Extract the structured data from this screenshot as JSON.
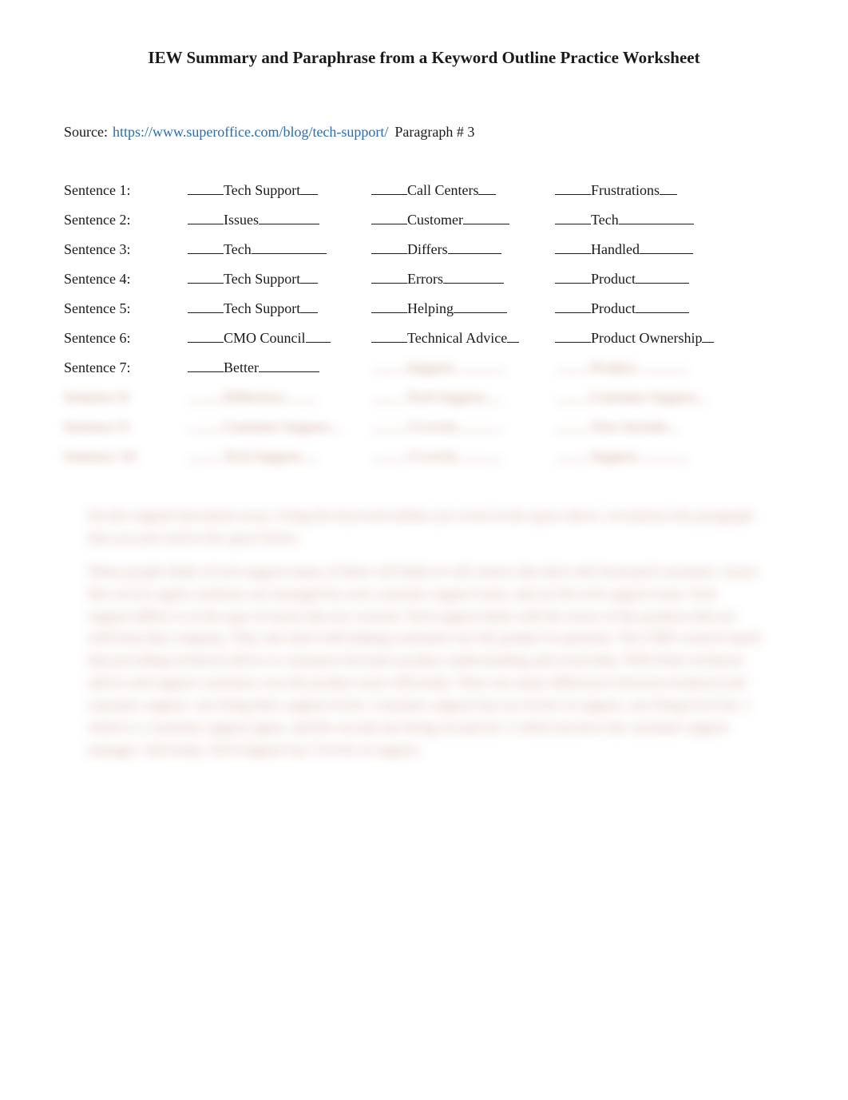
{
  "title": "IEW Summary and Paraphrase from a Keyword Outline Practice Worksheet",
  "source": {
    "label": "Source:",
    "url": "https://www.superoffice.com/blog/tech-support/",
    "paragraph_label": "Paragraph # 3"
  },
  "sentences": [
    {
      "label": "Sentence 1:",
      "keywords": [
        "Tech Support",
        "Call Centers",
        "Frustrations"
      ],
      "blurred": false
    },
    {
      "label": "Sentence 2:",
      "keywords": [
        "Issues",
        "Customer",
        "Tech"
      ],
      "blurred": false
    },
    {
      "label": "Sentence 3:",
      "keywords": [
        "Tech",
        "Differs",
        "Handled"
      ],
      "blurred": false
    },
    {
      "label": "Sentence 4:",
      "keywords": [
        "Tech Support",
        "Errors",
        "Product"
      ],
      "blurred": false
    },
    {
      "label": "Sentence 5:",
      "keywords": [
        "Tech Support",
        "Helping",
        "Product"
      ],
      "blurred": false
    },
    {
      "label": "Sentence 6:",
      "keywords": [
        "CMO Council",
        "Technical Advice",
        "Product Ownership"
      ],
      "blurred": false
    },
    {
      "label": "Sentence 7:",
      "keywords": [
        "Better",
        "Support",
        "Product"
      ],
      "blurred": false,
      "partial_blur": true
    },
    {
      "label": "Sentence 8:",
      "keywords": [
        "Difference",
        "Tech Support",
        "Customer Support"
      ],
      "blurred": true
    },
    {
      "label": "Sentence 9:",
      "keywords": [
        "Customer Support",
        "3 Levels",
        "Tiers Include"
      ],
      "blurred": true
    },
    {
      "label": "Sentence 10:",
      "keywords": [
        "Tech Support",
        "5 Levels",
        "Support"
      ],
      "blurred": true
    }
  ],
  "instructions": {
    "p1": "Set the original document away. Using the keyword outline you wrote in the space above, reconstruct the paragraph that you just read in the space below.",
    "p2": "When people think of tech support many of them will think of call centers that deal with frustrated customers. Issues like service agent continues are managed by your customer support team, and yet the tech support team. Tech support differs is in the type of issues that are covered. Tech support deals with the errors of the products that are sold from that company. They also deal with helping customers use the product in question. The CMO council stated that providing technical advice to customers becomes product understanding and ownership. With better technical advice and support customers own the product more efficiently. There are many differences between technical and customer support. one being their support levels. Customer support has two levels of support, one being level tier 1 which is a customer support agent, and the second one being second tier 2 which involves the customer support manager. And lastly, Tech Support has 5 levels of support."
  }
}
